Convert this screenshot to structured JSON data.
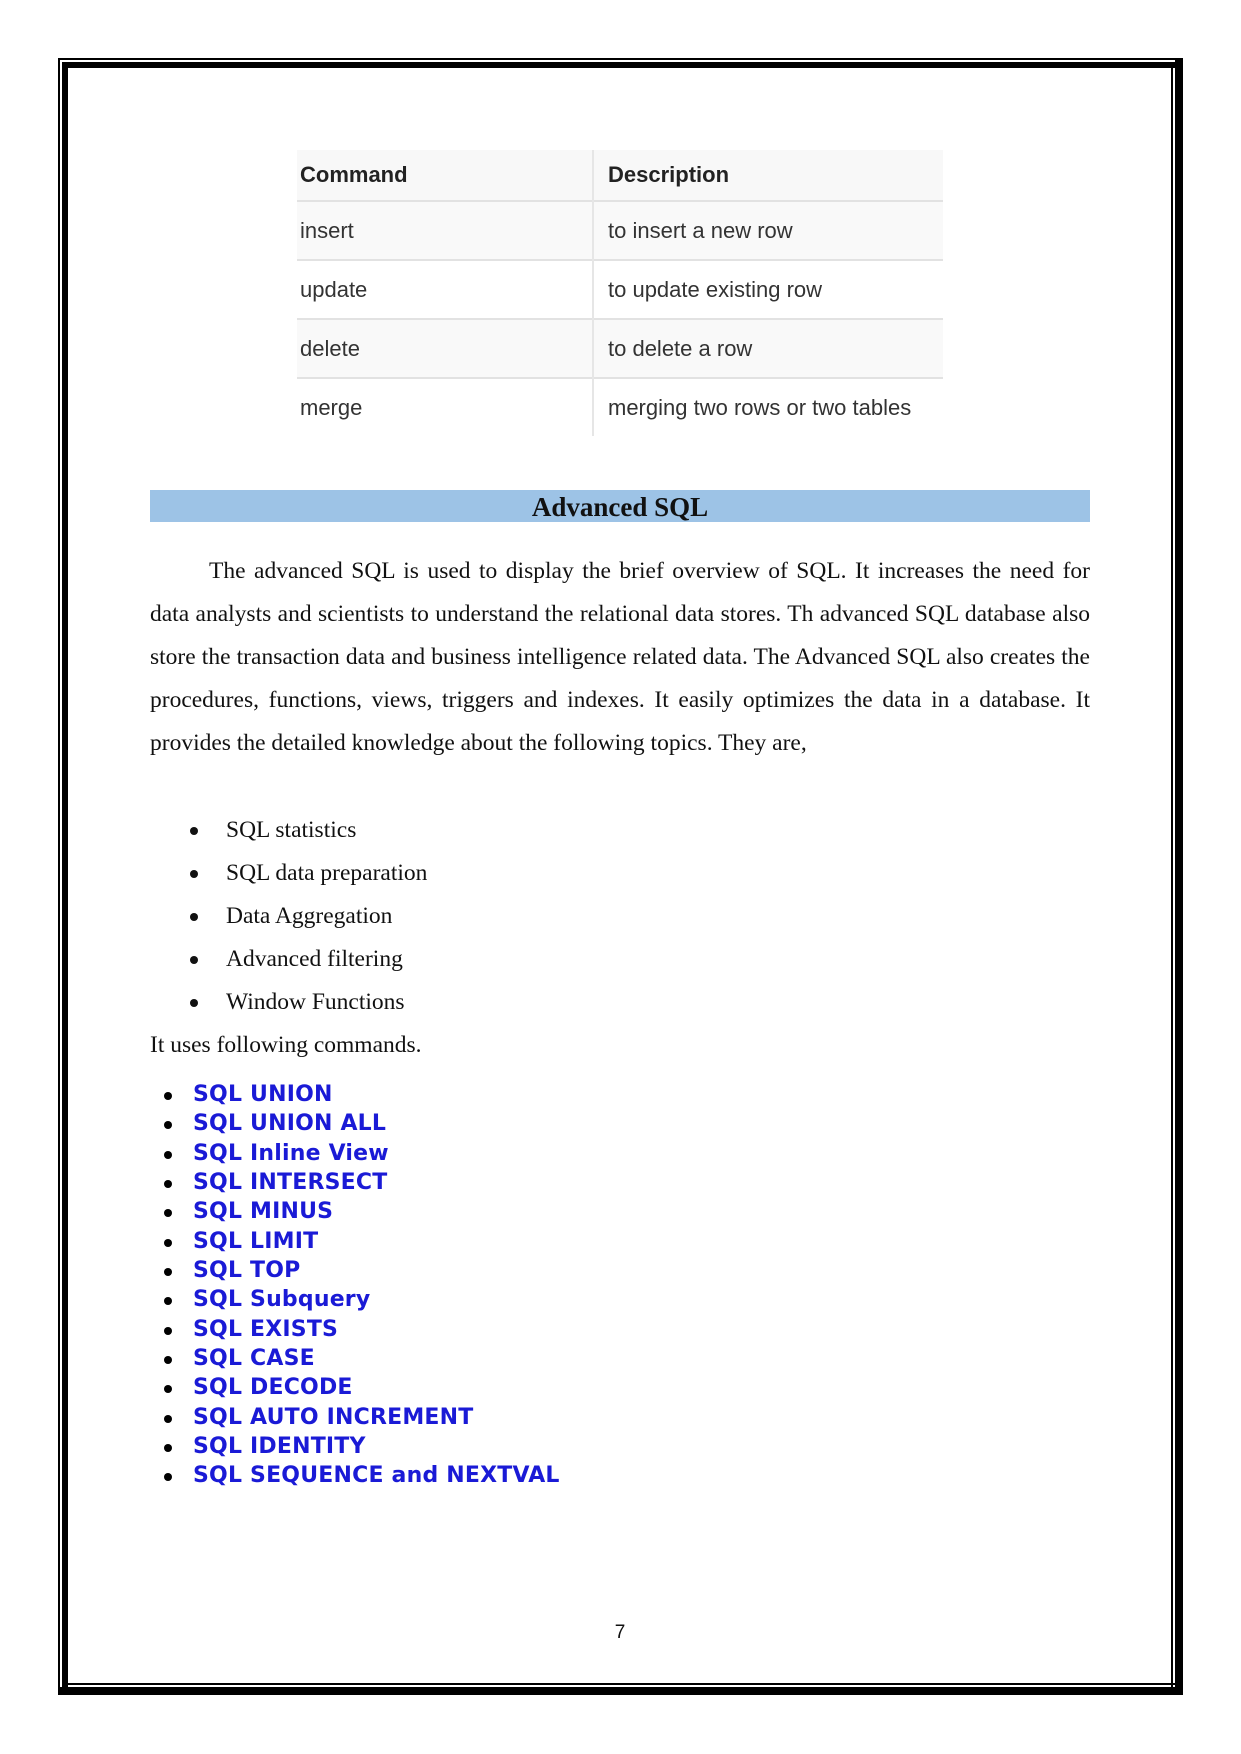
{
  "table": {
    "headers": [
      "Command",
      "Description"
    ],
    "rows": [
      {
        "command": "insert",
        "description": "to insert a new row"
      },
      {
        "command": "update",
        "description": "to update existing row"
      },
      {
        "command": "delete",
        "description": "to delete a row"
      },
      {
        "command": "merge",
        "description": "merging two rows or two tables"
      }
    ]
  },
  "section": {
    "heading": "Advanced SQL",
    "band_color": "#9dc3e6",
    "paragraph": "The advanced SQL is used to display the brief overview of SQL. It increases the need for data analysts and scientists to understand the relational data stores. Th advanced SQL database also store the transaction data and business intelligence related data. The Advanced SQL also creates the procedures, functions, views, triggers and indexes. It easily optimizes the data in a database. It provides the detailed knowledge about the following topics. They are,",
    "topics": [
      "SQL statistics",
      "SQL data preparation",
      "Data Aggregation",
      "Advanced filtering",
      "Window Functions"
    ],
    "lead": "It uses following commands.",
    "commands": [
      "SQL UNION",
      "SQL UNION ALL",
      "SQL Inline View",
      "SQL INTERSECT",
      "SQL MINUS",
      "SQL LIMIT",
      "SQL TOP",
      "SQL Subquery",
      "SQL EXISTS",
      "SQL CASE",
      "SQL DECODE",
      "SQL AUTO INCREMENT",
      "SQL IDENTITY",
      "SQL SEQUENCE and NEXTVAL"
    ],
    "link_color": "#1a1ad6"
  },
  "footer": {
    "page_number": "7"
  }
}
